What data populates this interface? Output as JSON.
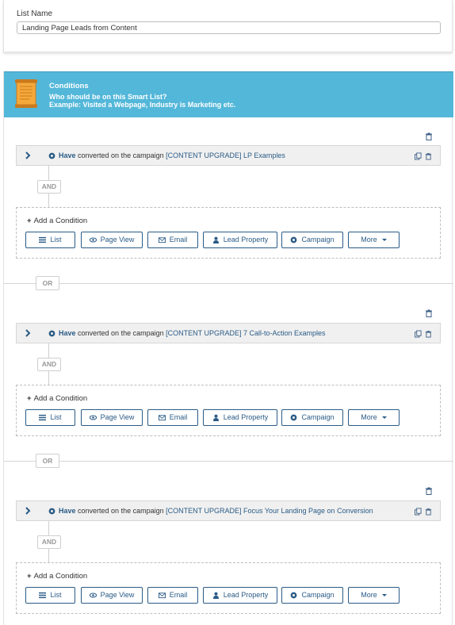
{
  "list_name": {
    "label": "List Name",
    "value": "Landing Page Leads from Content"
  },
  "conditions_header": {
    "title": "Conditions",
    "question": "Who should be on this Smart List?",
    "example": "Example: Visited a Webpage, Industry is Marketing etc.",
    "color": "#53b7d9"
  },
  "filters": [
    {
      "verb": "Have",
      "text": "converted on the campaign",
      "campaign": "[CONTENT UPGRADE] LP Examples"
    },
    {
      "verb": "Have",
      "text": "converted on the campaign",
      "campaign": "[CONTENT UPGRADE] 7 Call-to-Action Examples"
    },
    {
      "verb": "Have",
      "text": "converted on the campaign",
      "campaign": "[CONTENT UPGRADE] Focus Your Landing Page on Conversion"
    }
  ],
  "and_label": "AND",
  "or_label": "OR",
  "add_condition_label": "Add a Condition",
  "add_condition_plus": "+",
  "buttons": [
    {
      "label": "List",
      "icon": "list-icon"
    },
    {
      "label": "Page View",
      "icon": "eye-icon"
    },
    {
      "label": "Email",
      "icon": "envelope-icon"
    },
    {
      "label": "Lead Property",
      "icon": "person-icon"
    },
    {
      "label": "Campaign",
      "icon": "gear-icon"
    },
    {
      "label": "More",
      "icon": "caret-down-icon"
    }
  ],
  "colors": {
    "accent": "#2a5b86",
    "header": "#53b7d9"
  }
}
